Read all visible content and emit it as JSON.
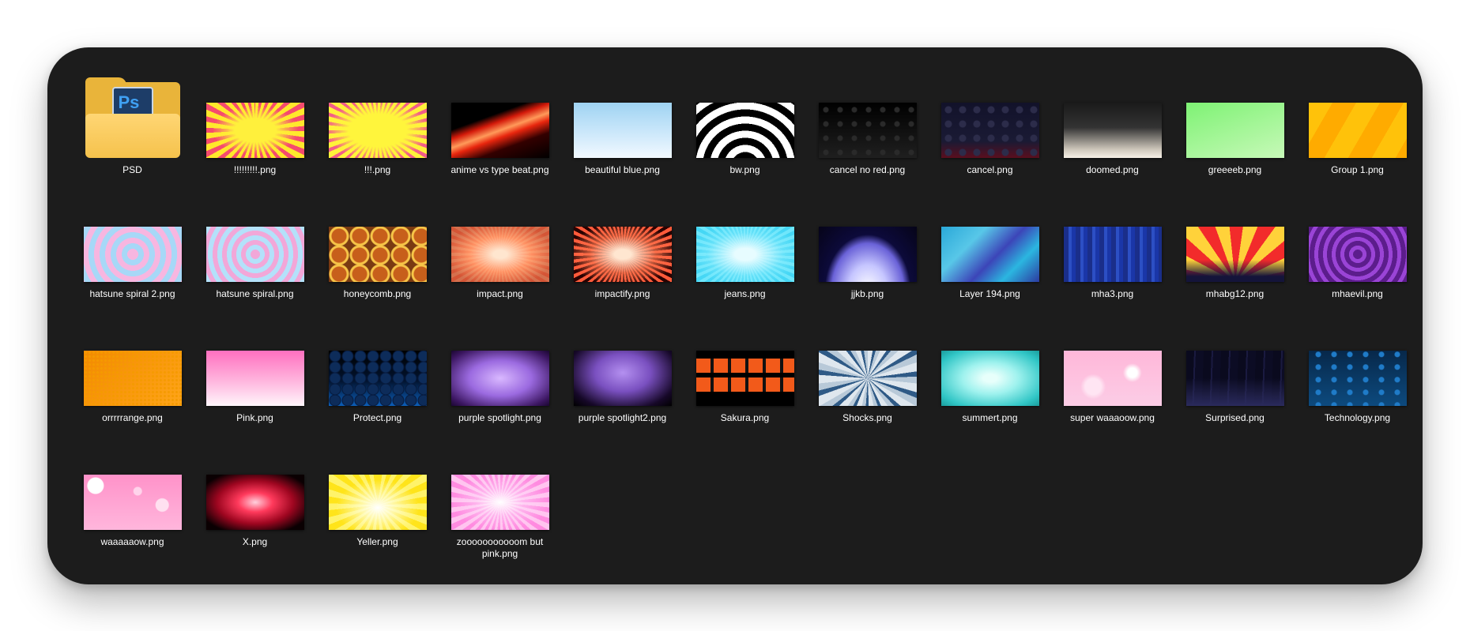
{
  "folder": {
    "label": "PSD",
    "icon": "photoshop-folder-icon",
    "badge": "Ps"
  },
  "files": [
    {
      "name": "!!!!!!!!!.png",
      "thumb": "burst-red"
    },
    {
      "name": "!!!.png",
      "thumb": "burst-yel"
    },
    {
      "name": "anime vs type beat.png",
      "thumb": "anime"
    },
    {
      "name": "beautiful blue.png",
      "thumb": "blue"
    },
    {
      "name": "bw.png",
      "thumb": "bw"
    },
    {
      "name": "cancel no red.png",
      "thumb": "cancel-nored"
    },
    {
      "name": "cancel.png",
      "thumb": "cancel"
    },
    {
      "name": "doomed.png",
      "thumb": "doomed"
    },
    {
      "name": "greeeeb.png",
      "thumb": "green"
    },
    {
      "name": "Group 1.png",
      "thumb": "group1"
    },
    {
      "name": "hatsune spiral 2.png",
      "thumb": "spiral"
    },
    {
      "name": "hatsune spiral.png",
      "thumb": "spiral2"
    },
    {
      "name": "honeycomb.png",
      "thumb": "honey"
    },
    {
      "name": "impact.png",
      "thumb": "impact"
    },
    {
      "name": "impactify.png",
      "thumb": "impactify"
    },
    {
      "name": "jeans.png",
      "thumb": "jeans"
    },
    {
      "name": "jjkb.png",
      "thumb": "jjkb"
    },
    {
      "name": "Layer 194.png",
      "thumb": "layer194"
    },
    {
      "name": "mha3.png",
      "thumb": "mha3"
    },
    {
      "name": "mhabg12.png",
      "thumb": "mhabg12"
    },
    {
      "name": "mhaevil.png",
      "thumb": "mhaevil"
    },
    {
      "name": "orrrrrange.png",
      "thumb": "orange"
    },
    {
      "name": "Pink.png",
      "thumb": "pink"
    },
    {
      "name": "Protect.png",
      "thumb": "protect"
    },
    {
      "name": "purple spotlight.png",
      "thumb": "purple"
    },
    {
      "name": "purple spotlight2.png",
      "thumb": "purple2"
    },
    {
      "name": "Sakura.png",
      "thumb": "sakura"
    },
    {
      "name": "Shocks.png",
      "thumb": "shocks"
    },
    {
      "name": "summert.png",
      "thumb": "summert"
    },
    {
      "name": "super waaaoow.png",
      "thumb": "superwaaa"
    },
    {
      "name": "Surprised.png",
      "thumb": "surprised"
    },
    {
      "name": "Technology.png",
      "thumb": "tech"
    },
    {
      "name": "waaaaaow.png",
      "thumb": "waaaaow"
    },
    {
      "name": "X.png",
      "thumb": "x"
    },
    {
      "name": "Yeller.png",
      "thumb": "yeller"
    },
    {
      "name": "zooooooooooom but pink.png",
      "thumb": "zoom"
    }
  ],
  "colors": {
    "panel": "#1c1c1c",
    "label": "#ffffff",
    "folder": "#f5c24c"
  }
}
